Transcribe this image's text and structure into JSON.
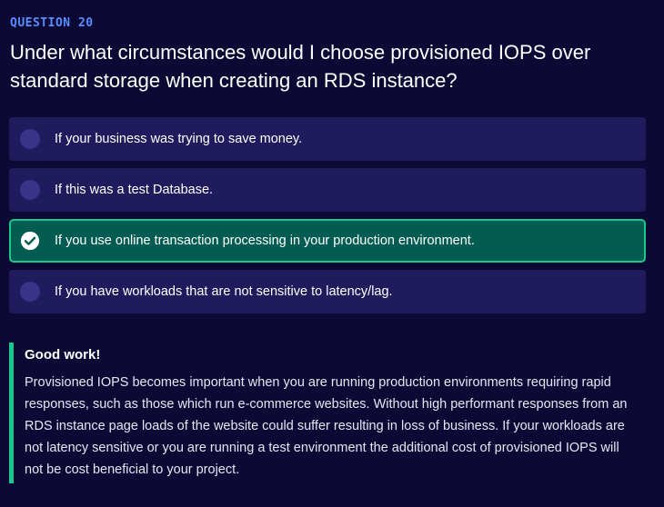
{
  "question": {
    "label": "QUESTION 20",
    "text": "Under what circumstances would I choose provisioned IOPS over standard storage when creating an RDS instance?"
  },
  "options": [
    {
      "text": "If your business was trying to save money.",
      "state": "unselected"
    },
    {
      "text": "If this was a test Database.",
      "state": "unselected"
    },
    {
      "text": "If you use online transaction processing in your production environment.",
      "state": "correct"
    },
    {
      "text": "If you have workloads that are not sensitive to latency/lag.",
      "state": "unselected"
    }
  ],
  "feedback": {
    "title": "Good work!",
    "body": "Provisioned IOPS becomes important when you are running production environments requiring rapid responses, such as those which run e-commerce websites. Without high performant responses from an RDS instance page loads of the website could suffer resulting in loss of business. If your workloads are not latency sensitive or you are running a test environment the additional cost of provisioned IOPS will not be cost beneficial to your project."
  },
  "colors": {
    "background": "#0c0a35",
    "accent_label": "#5a8dff",
    "option_bg": "#1f1b5c",
    "radio": "#39348a",
    "correct_bg": "#035c52",
    "correct_border": "#19c98b"
  }
}
